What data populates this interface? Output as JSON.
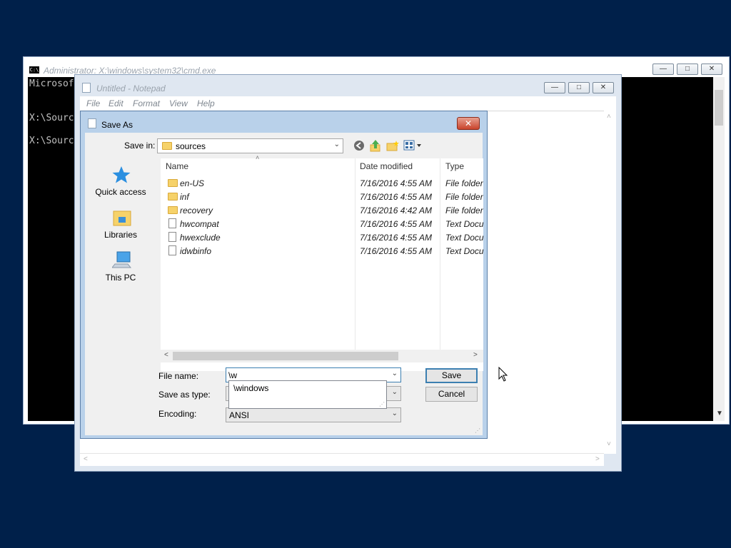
{
  "cmd": {
    "title": "Administrator: X:\\windows\\system32\\cmd.exe",
    "icon": "console-app-icon",
    "lines": [
      "Microsof",
      "",
      "X:\\Sourc",
      "",
      "X:\\Sourc"
    ]
  },
  "notepad": {
    "title": "Untitled - Notepad",
    "menu": [
      "File",
      "Edit",
      "Format",
      "View",
      "Help"
    ]
  },
  "dialog": {
    "title": "Save As",
    "save_in_label": "Save in:",
    "save_in_value": "sources",
    "places": [
      {
        "label": "Quick access",
        "icon": "star-icon"
      },
      {
        "label": "Libraries",
        "icon": "libraries-icon"
      },
      {
        "label": "This PC",
        "icon": "computer-icon"
      }
    ],
    "columns": [
      "Name",
      "Date modified",
      "Type"
    ],
    "files": [
      {
        "name": "en-US",
        "date": "7/16/2016 4:55 AM",
        "type": "File folder",
        "kind": "folder"
      },
      {
        "name": "inf",
        "date": "7/16/2016 4:55 AM",
        "type": "File folder",
        "kind": "folder"
      },
      {
        "name": "recovery",
        "date": "7/16/2016 4:42 AM",
        "type": "File folder",
        "kind": "folder"
      },
      {
        "name": "hwcompat",
        "date": "7/16/2016 4:55 AM",
        "type": "Text Docu",
        "kind": "file"
      },
      {
        "name": "hwexclude",
        "date": "7/16/2016 4:55 AM",
        "type": "Text Docu",
        "kind": "file"
      },
      {
        "name": "idwbinfo",
        "date": "7/16/2016 4:55 AM",
        "type": "Text Docu",
        "kind": "file"
      }
    ],
    "file_name_label": "File name:",
    "file_name_value": "\\w",
    "autocomplete": [
      "\\windows"
    ],
    "save_as_type_label": "Save as type:",
    "encoding_label": "Encoding:",
    "encoding_value": "ANSI",
    "save_button": "Save",
    "cancel_button": "Cancel"
  },
  "colors": {
    "desktop": "#00204a",
    "dialog_frame": "#b9d1ea",
    "close_red": "#c9442c"
  }
}
